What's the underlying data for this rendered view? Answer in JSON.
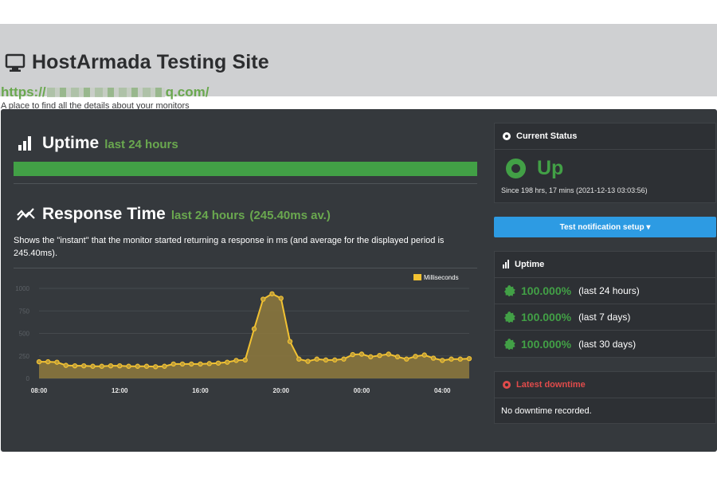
{
  "header": {
    "icon": "monitor-icon",
    "title": "HostArmada Testing Site",
    "url_prefix": "https://",
    "url_suffix": "q.com/",
    "tagline": "A place to find all the details about your monitors"
  },
  "uptime_section": {
    "icon": "bar-chart-icon",
    "title": "Uptime",
    "subtitle": "last 24 hours",
    "percent": 100,
    "bar_color": "#42a046"
  },
  "response_section": {
    "icon": "trend-icon",
    "title": "Response Time",
    "subtitle": "last 24 hours",
    "average": "(245.40ms av.)",
    "description": "Shows the \"instant\" that the monitor started returning a response in ms (and average for the displayed period is 245.40ms)."
  },
  "chart_data": {
    "type": "area",
    "legend": "Milliseconds",
    "legend_position": "top-right",
    "ylim": [
      0,
      1000
    ],
    "yticks": [
      "1000",
      "750",
      "500",
      "250",
      "0"
    ],
    "xtick_labels": [
      "08:00",
      "12:00",
      "16:00",
      "20:00",
      "00:00",
      "04:00"
    ],
    "xtick_index": [
      0,
      9,
      18,
      27,
      36,
      45
    ],
    "series": [
      {
        "values": [
          185,
          185,
          180,
          145,
          140,
          140,
          135,
          135,
          140,
          140,
          135,
          135,
          135,
          130,
          135,
          160,
          160,
          160,
          160,
          165,
          170,
          180,
          200,
          205,
          550,
          880,
          940,
          890,
          410,
          215,
          190,
          215,
          205,
          205,
          215,
          265,
          270,
          240,
          255,
          270,
          240,
          215,
          245,
          260,
          225,
          200,
          215,
          215,
          220
        ]
      }
    ],
    "line_color": "#f2c232",
    "fill_color": "#8e7a3d",
    "grid": true
  },
  "current_status": {
    "title": "Current Status",
    "status": "Up",
    "since": "Since 198 hrs, 17 mins (2021-12-13 03:03:56)",
    "color": "#42a046"
  },
  "notify_button": {
    "label": "Test notification setup ▾",
    "color": "#2d9be3"
  },
  "uptime_card": {
    "title": "Uptime",
    "rows": [
      {
        "percent": "100.000%",
        "period": "(last 24 hours)"
      },
      {
        "percent": "100.000%",
        "period": "(last 7 days)"
      },
      {
        "percent": "100.000%",
        "period": "(last 30 days)"
      }
    ]
  },
  "latest_downtime": {
    "title": "Latest downtime",
    "message": "No downtime recorded."
  }
}
